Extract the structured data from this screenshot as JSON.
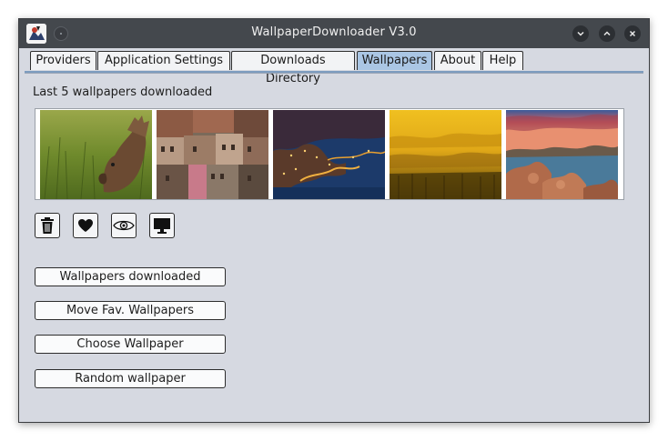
{
  "window": {
    "title": "WallpaperDownloader V3.0"
  },
  "tabs": [
    {
      "label": "Providers"
    },
    {
      "label": "Application Settings"
    },
    {
      "label": "Downloads Directory"
    },
    {
      "label": "Wallpapers",
      "active": true
    },
    {
      "label": "About"
    },
    {
      "label": "Help"
    }
  ],
  "wallpapers": {
    "section_label": "Last 5 wallpapers downloaded",
    "thumbnails": [
      "bird-in-grass",
      "old-town-rooftops",
      "coastal-town-night",
      "misty-forest-sunrise",
      "rocky-lake-sunset"
    ]
  },
  "toolbar_icons": [
    "trash-icon",
    "heart-icon",
    "eye-icon",
    "monitor-icon"
  ],
  "buttons": {
    "downloaded": "Wallpapers downloaded",
    "move_fav": "Move Fav. Wallpapers",
    "choose": "Choose Wallpaper",
    "random": "Random wallpaper"
  },
  "colors": {
    "titlebar": "#44484d",
    "window_bg": "#d6d9e1",
    "active_tab": "#aac6e4",
    "tab_underline": "#7d9cbf"
  }
}
